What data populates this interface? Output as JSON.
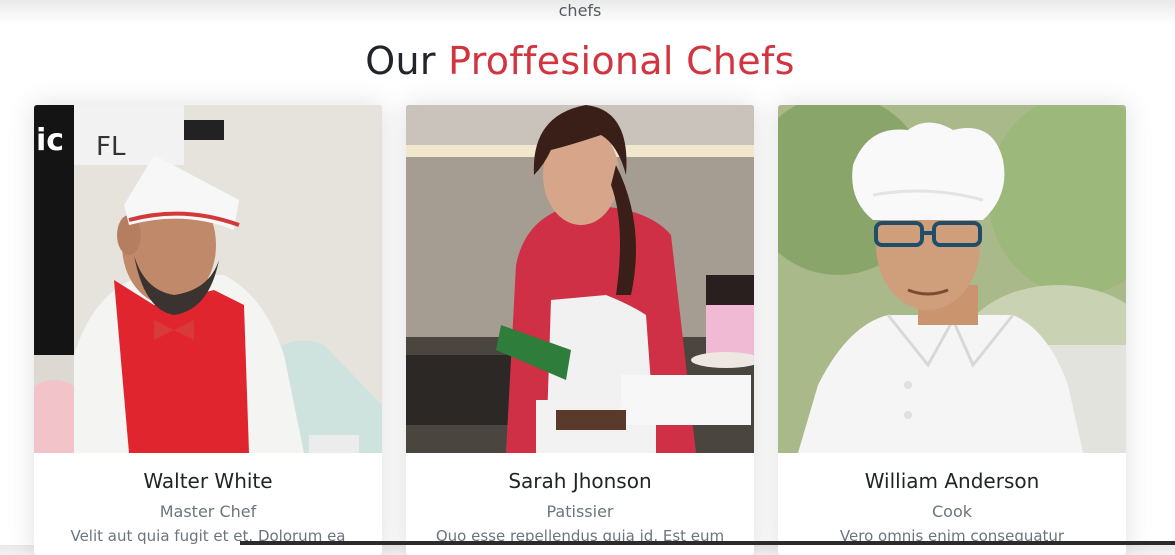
{
  "section": {
    "subtitle": "chefs",
    "title_prefix": "Our",
    "title_accent": "Proffesional Chefs",
    "accent_color": "#d2353f"
  },
  "chefs": [
    {
      "name": "Walter White",
      "role": "Master Chef",
      "description": "Velit aut quia fugit et et. Dolorum ea"
    },
    {
      "name": "Sarah Jhonson",
      "role": "Patissier",
      "description": "Quo esse repellendus quia id. Est eum"
    },
    {
      "name": "William Anderson",
      "role": "Cook",
      "description": "Vero omnis enim consequatur"
    }
  ]
}
